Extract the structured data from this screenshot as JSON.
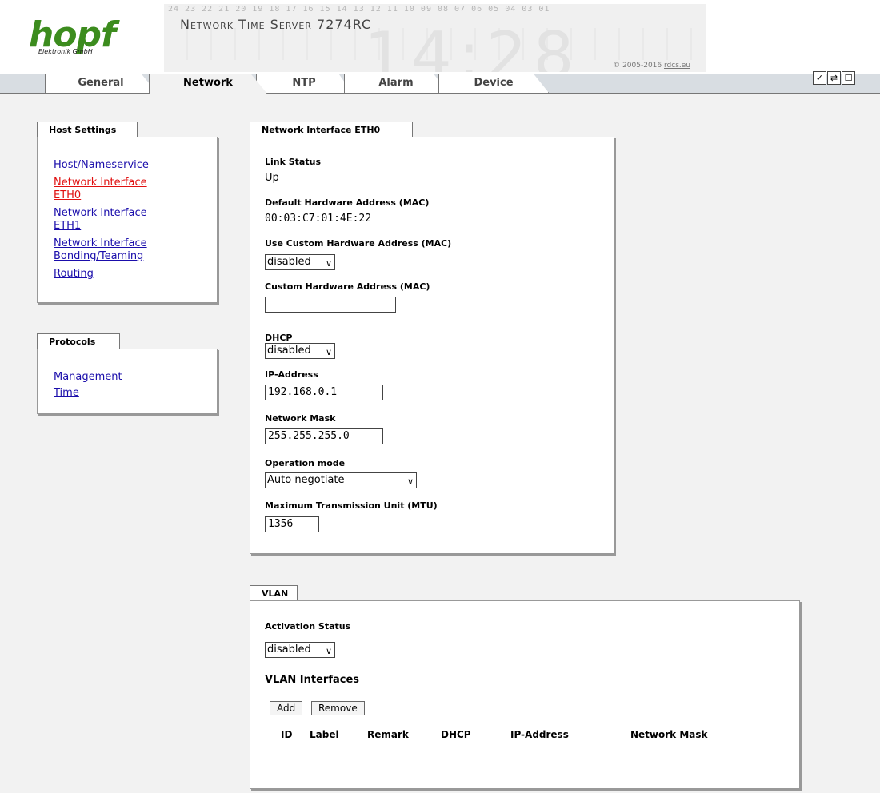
{
  "header": {
    "logo_text": "hopf",
    "logo_sub": "Elektronik  GmbH",
    "banner_digits": "24 23 22 21 20 19 18 17 16 15 14 13 12 11 10 09 08 07 06 05 04 03 01",
    "product_title": "Network Time Server 7274RC",
    "big_clock": "14:28",
    "copyright_text": "© 2005-2016 ",
    "copyright_link": "rdcs.eu"
  },
  "tabs": [
    {
      "label": "General"
    },
    {
      "label": "Network",
      "active": true
    },
    {
      "label": "NTP"
    },
    {
      "label": "Alarm"
    },
    {
      "label": "Device"
    }
  ],
  "toolbar_icons": [
    "check-icon",
    "refresh-icon",
    "page-icon"
  ],
  "toolbar_glyphs": [
    "✓",
    "⇄",
    "☐"
  ],
  "host_settings": {
    "title": "Host Settings",
    "links": [
      {
        "line1": "Host/Nameservice",
        "line2": ""
      },
      {
        "line1": "Network Interface",
        "line2": "ETH0",
        "current": true
      },
      {
        "line1": "Network Interface",
        "line2": "ETH1"
      },
      {
        "line1": "Network Interface",
        "line2": "Bonding/Teaming"
      },
      {
        "line1": "Routing",
        "line2": ""
      }
    ]
  },
  "protocols": {
    "title": "Protocols",
    "links": [
      "Management",
      "Time"
    ]
  },
  "eth0": {
    "title": "Network Interface ETH0",
    "link_status_label": "Link Status",
    "link_status_value": "Up",
    "default_mac_label": "Default Hardware Address (MAC)",
    "default_mac_value": "00:03:C7:01:4E:22",
    "custom_mac_toggle_label": "Use Custom Hardware Address (MAC)",
    "custom_mac_toggle_value": "disabled",
    "custom_mac_label": "Custom Hardware Address (MAC)",
    "custom_mac_value": "",
    "dhcp_label": "DHCP",
    "dhcp_value": "disabled",
    "ip_label": "IP-Address",
    "ip_value": "192.168.0.1",
    "mask_label": "Network Mask",
    "mask_value": "255.255.255.0",
    "opmode_label": "Operation mode",
    "opmode_value": "Auto negotiate",
    "mtu_label": "Maximum Transmission Unit (MTU)",
    "mtu_value": "1356"
  },
  "vlan": {
    "title": "VLAN",
    "activation_label": "Activation Status",
    "activation_value": "disabled",
    "interfaces_heading": "VLAN Interfaces",
    "add_label": "Add",
    "remove_label": "Remove",
    "columns": [
      "ID",
      "Label",
      "Remark",
      "DHCP",
      "IP-Address",
      "Network Mask"
    ]
  },
  "glyphs": {
    "dropdown_arrow": "∨"
  }
}
